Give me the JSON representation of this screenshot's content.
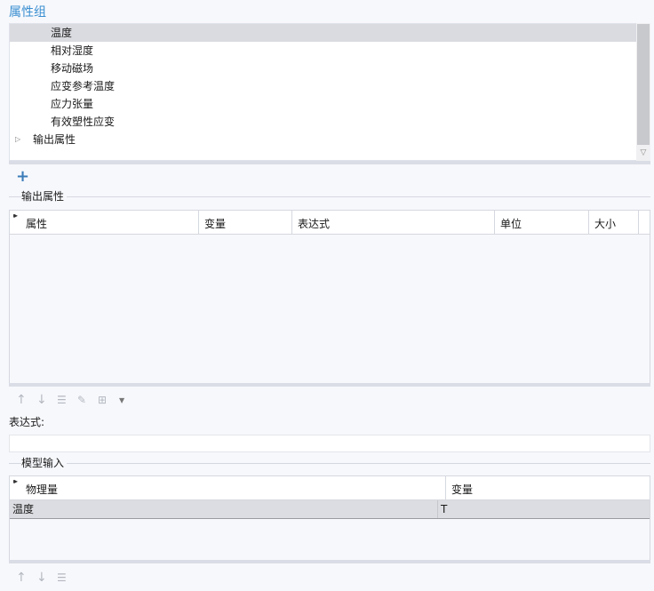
{
  "section": {
    "title": "属性组"
  },
  "tree": {
    "items": [
      {
        "label": "温度",
        "selected": true
      },
      {
        "label": "相对湿度"
      },
      {
        "label": "移动磁场"
      },
      {
        "label": "应变参考温度"
      },
      {
        "label": "应力张量"
      },
      {
        "label": "有效塑性应变"
      }
    ],
    "group": {
      "label": "输出属性"
    }
  },
  "toolbar_top": {
    "add_icon": "plus-icon"
  },
  "output_props": {
    "legend": "输出属性",
    "columns": [
      "属性",
      "变量",
      "表达式",
      "单位",
      "大小"
    ],
    "rows": []
  },
  "toolbar_mid": {
    "icons": [
      "arrow-up-icon",
      "arrow-down-icon",
      "delete-list-icon",
      "edit-icon",
      "table-options-icon",
      "dropdown-arrow-icon"
    ]
  },
  "expression": {
    "label": "表达式:",
    "value": ""
  },
  "model_inputs": {
    "legend": "模型输入",
    "columns": [
      "物理量",
      "变量"
    ],
    "rows": [
      {
        "quantity": "温度",
        "variable": "T"
      }
    ]
  },
  "toolbar_bottom": {
    "icons": [
      "arrow-up-icon",
      "arrow-down-icon",
      "delete-list-icon"
    ]
  }
}
